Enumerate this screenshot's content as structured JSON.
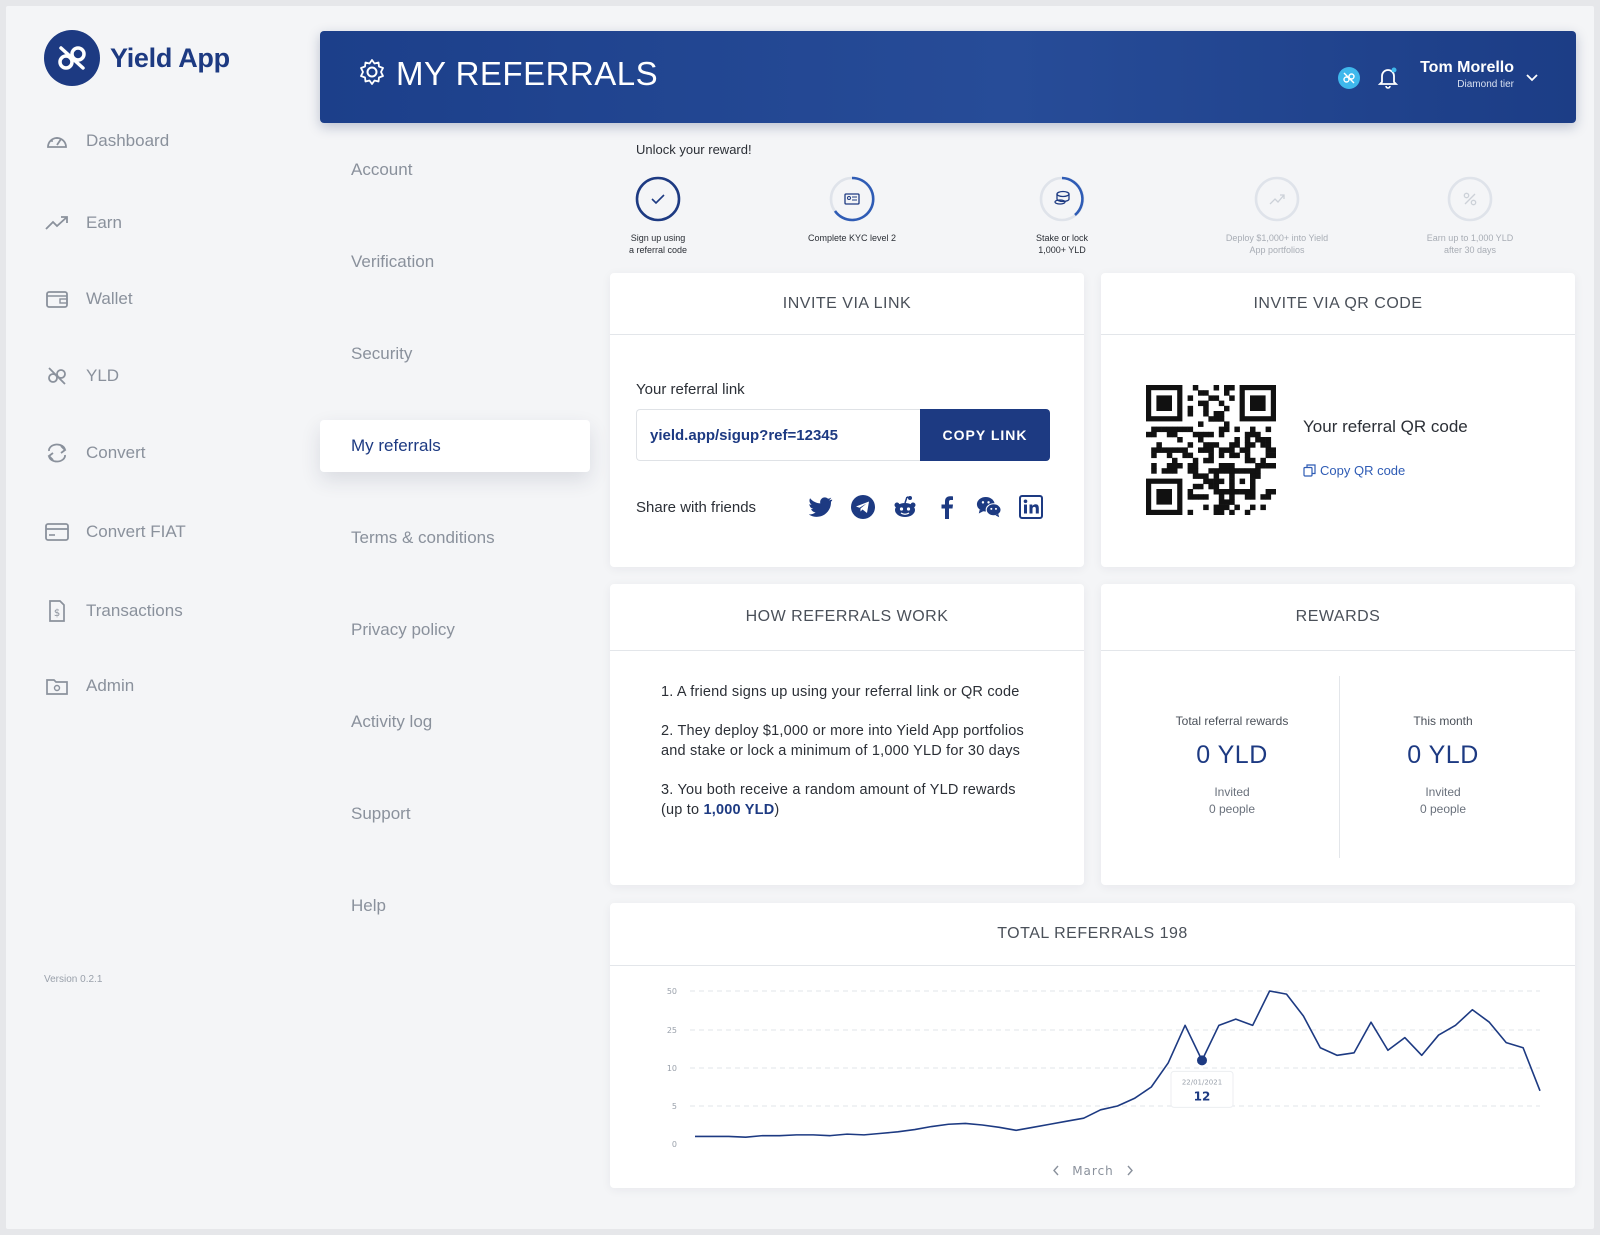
{
  "app": {
    "name": "Yield App",
    "version": "Version 0.2.1"
  },
  "sidebar": {
    "items": [
      {
        "label": "Dashboard",
        "icon": "dashboard-icon"
      },
      {
        "label": "Earn",
        "icon": "trend-up-icon"
      },
      {
        "label": "Wallet",
        "icon": "wallet-icon"
      },
      {
        "label": "YLD",
        "icon": "yld-icon"
      },
      {
        "label": "Convert",
        "icon": "convert-icon"
      },
      {
        "label": "Convert FIAT",
        "icon": "card-icon"
      },
      {
        "label": "Transactions",
        "icon": "receipt-icon"
      },
      {
        "label": "Admin",
        "icon": "admin-folder-icon"
      }
    ]
  },
  "header": {
    "title": "MY REFERRALS",
    "user_name": "Tom Morello",
    "user_tier": "Diamond tier"
  },
  "subnav": {
    "items": [
      "Account",
      "Verification",
      "Security",
      "My referrals",
      "Terms & conditions",
      "Privacy policy",
      "Activity log",
      "Support",
      "Help"
    ],
    "active": "My referrals"
  },
  "progress": {
    "title": "Unlock your reward!",
    "steps": [
      {
        "label_1": "Sign up using",
        "label_2": "a referral code",
        "state": "done"
      },
      {
        "label_1": "Complete KYC level 2",
        "label_2": "",
        "state": "partial"
      },
      {
        "label_1": "Stake or lock",
        "label_2": "1,000+ YLD",
        "state": "partial"
      },
      {
        "label_1": "Deploy $1,000+ into Yield",
        "label_2": "App portfolios",
        "state": "locked"
      },
      {
        "label_1": "Earn up to 1,000 YLD",
        "label_2": "after 30 days",
        "state": "locked"
      }
    ]
  },
  "invite_link": {
    "heading": "INVITE VIA LINK",
    "label": "Your referral link",
    "value": "yield.app/sigup?ref=12345",
    "button": "COPY LINK",
    "share_label": "Share with friends",
    "socials": [
      "twitter-icon",
      "telegram-icon",
      "reddit-icon",
      "facebook-icon",
      "wechat-icon",
      "linkedin-icon"
    ]
  },
  "invite_qr": {
    "heading": "INVITE VIA QR CODE",
    "title": "Your referral QR code",
    "copy": "Copy QR code"
  },
  "how": {
    "heading": "HOW REFERRALS WORK",
    "step1": "1. A friend signs up using your referral link or QR code",
    "step2": "2. They deploy $1,000 or more into Yield App portfolios and stake or lock a minimum of 1,000 YLD for 30 days",
    "step3_pre": "3. You both receive a random amount of YLD rewards (up to ",
    "step3_bold": "1,000 YLD",
    "step3_post": ")"
  },
  "rewards": {
    "heading": "REWARDS",
    "total": {
      "caption": "Total referral rewards",
      "value": "0 YLD",
      "invited": "Invited",
      "people": "0 people"
    },
    "month": {
      "caption": "This month",
      "value": "0 YLD",
      "invited": "Invited",
      "people": "0 people"
    }
  },
  "chart": {
    "heading": "TOTAL REFERRALS 198",
    "month_label": "March",
    "tooltip_date": "22/01/2021",
    "tooltip_value": "12"
  },
  "colors": {
    "brand": "#1d3a82",
    "accent": "#3fb8ec",
    "muted": "#8a919c"
  },
  "chart_data": {
    "type": "line",
    "title": "TOTAL REFERRALS 198",
    "xlabel": "March",
    "ylabel": "",
    "y_ticks": [
      0,
      5,
      10,
      25,
      50
    ],
    "grid": true,
    "highlight": {
      "index": 28,
      "date": "22/01/2021",
      "value": 12
    },
    "series": [
      {
        "values": [
          1,
          1,
          1,
          0.9,
          1.1,
          1.1,
          1.2,
          1.2,
          1.1,
          1.3,
          1.2,
          1.4,
          1.6,
          1.9,
          2.3,
          2.6,
          2.7,
          2.5,
          2.2,
          1.8,
          2.2,
          2.6,
          3,
          3.4,
          4.5,
          5,
          6,
          7.5,
          12,
          28,
          13,
          28,
          32,
          28,
          50,
          48,
          34,
          18,
          15,
          16,
          30,
          17,
          22,
          15,
          23,
          28,
          38,
          30,
          20,
          18,
          7
        ]
      }
    ]
  }
}
